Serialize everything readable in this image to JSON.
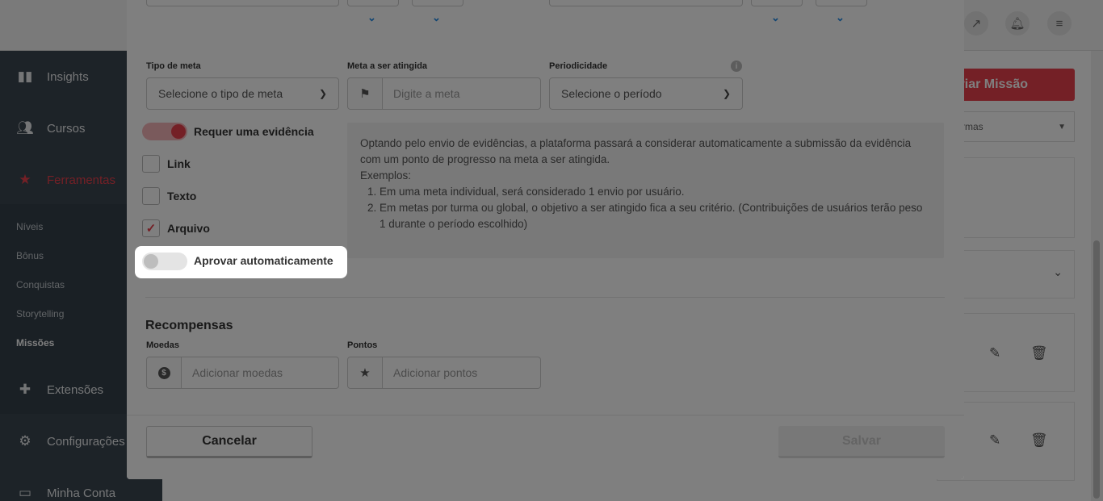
{
  "app": {
    "sidebar": {
      "items": [
        {
          "label": "Insights",
          "icon": "bar-chart-icon"
        },
        {
          "label": "Cursos",
          "icon": "users-icon"
        },
        {
          "label": "Ferramentas",
          "icon": "star-icon"
        },
        {
          "label": "Extensões",
          "icon": "puzzle-icon"
        },
        {
          "label": "Configurações",
          "icon": "gear-icon"
        },
        {
          "label": "Minha Conta",
          "icon": "card-icon"
        }
      ],
      "subitems": [
        "Níveis",
        "Bônus",
        "Conquistas",
        "Storytelling",
        "Missões"
      ]
    },
    "create_button": "riar Missão",
    "filter_select": "rmas"
  },
  "modal": {
    "goal_type": {
      "label": "Tipo de meta",
      "value": "Selecione o tipo de meta"
    },
    "goal_target": {
      "label": "Meta a ser atingida",
      "placeholder": "Digite a meta"
    },
    "periodicity": {
      "label": "Periodicidade",
      "value": "Selecione o período"
    },
    "evidence_toggle": {
      "label": "Requer uma evidência",
      "state": "on"
    },
    "evidence_types": [
      {
        "label": "Link",
        "checked": false
      },
      {
        "label": "Texto",
        "checked": false
      },
      {
        "label": "Arquivo",
        "checked": true
      }
    ],
    "auto_approve_toggle": {
      "label": "Aprovar automaticamente",
      "state": "off"
    },
    "info": {
      "intro": "Optando pelo envio de evidências, a plataforma passará a considerar automaticamente a submissão da evidência com um ponto de progresso na meta a ser atingida.",
      "examples_label": "Exemplos:",
      "examples": [
        "Em uma meta individual, será considerado 1 envio por usuário.",
        "Em metas por turma ou global, o objetivo a ser atingido fica a seu critério. (Contribuições de usuários terão peso 1 durante o período escolhido)"
      ]
    },
    "rewards": {
      "title": "Recompensas",
      "coins": {
        "label": "Moedas",
        "placeholder": "Adicionar moedas"
      },
      "points": {
        "label": "Pontos",
        "placeholder": "Adicionar pontos"
      }
    },
    "cancel_label": "Cancelar",
    "save_label": "Salvar"
  },
  "colors": {
    "accent": "#e9404c",
    "sidebar": "#3b4651",
    "chevron": "#1e88e5"
  }
}
